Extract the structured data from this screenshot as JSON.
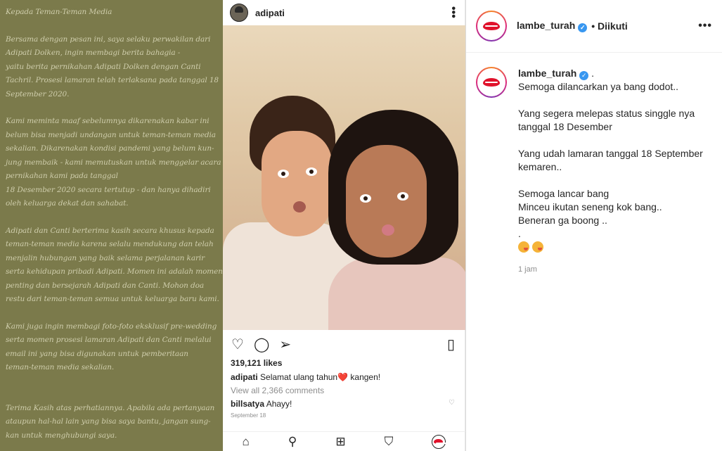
{
  "statement": {
    "lines": [
      "Kepada Teman-Teman Media",
      "",
      "Bersama dengan pesan ini, saya selaku perwakilan dari",
      "Adipati Dolken, ingin membagi berita bahagia -",
      "yaitu berita pernikahan Adipati Dolken dengan Canti",
      "Tachril. Prosesi lamaran telah terlaksana pada tanggal 18",
      "September 2020.",
      "",
      "Kami meminta maaf sebelumnya dikarenakan kabar ini",
      "belum bisa menjadi undangan untuk teman-teman media",
      "sekalian. Dikarenakan kondisi pandemi yang belum kun-",
      "jung membaik - kami memutuskan untuk menggelar acara",
      "pernikahan kami pada tanggal",
      "18 Desember 2020 secara tertutup - dan hanya dihadiri",
      "oleh keluarga dekat dan sahabat.",
      "",
      "Adipati dan Canti berterima kasih secara khusus kepada",
      "teman-teman media karena selalu mendukung dan telah",
      "menjalin hubungan yang baik selama perjalanan karir",
      "serta kehidupan pribadi Adipati. Momen ini adalah momen",
      "penting dan bersejarah Adipati dan Canti. Mohon doa",
      "restu dari teman-teman semua untuk keluarga baru kami.",
      "",
      "Kami juga ingin membagi foto-foto eksklusif pre-wedding",
      "serta momen prosesi lamaran Adipati  dan Canti melalui",
      "email ini yang bisa digunakan untuk pemberitaan",
      "teman-teman media sekalian.",
      "",
      "",
      "Terima Kasih atas perhatiannya. Apabila ada pertanyaan",
      "ataupun hal-hal lain yang bisa saya bantu, jangan sung-",
      "kan untuk menghubungi saya."
    ]
  },
  "phone_post": {
    "username": "adipati",
    "likes": "319,121 likes",
    "caption_user": "adipati",
    "caption_text_a": "Selamat ulang tahun",
    "caption_heart": "❤️",
    "caption_text_b": " kangen!",
    "view_all": "View all 2,366 comments",
    "comment_user": "billsatya",
    "comment_text": "Ahayy!",
    "date": "September 18"
  },
  "panel": {
    "username": "lambe_turah",
    "follow_status": "• Diikuti",
    "caption_suffix": " .",
    "caption_body": "Semoga dilancarkan ya bang dodot..\n\nYang segera melepas status singgle nya tanggal 18 Desember\n\nYang udah lamaran tanggal 18 September kemaren..\n\nSemoga lancar bang\nMinceu ikutan seneng kok bang..\nBeneran ga boong ..\n.",
    "time": "1 jam"
  },
  "colors": {
    "statement_bg": "#7b7a4b",
    "verified": "#3897f0",
    "heart": "#e0122b"
  }
}
